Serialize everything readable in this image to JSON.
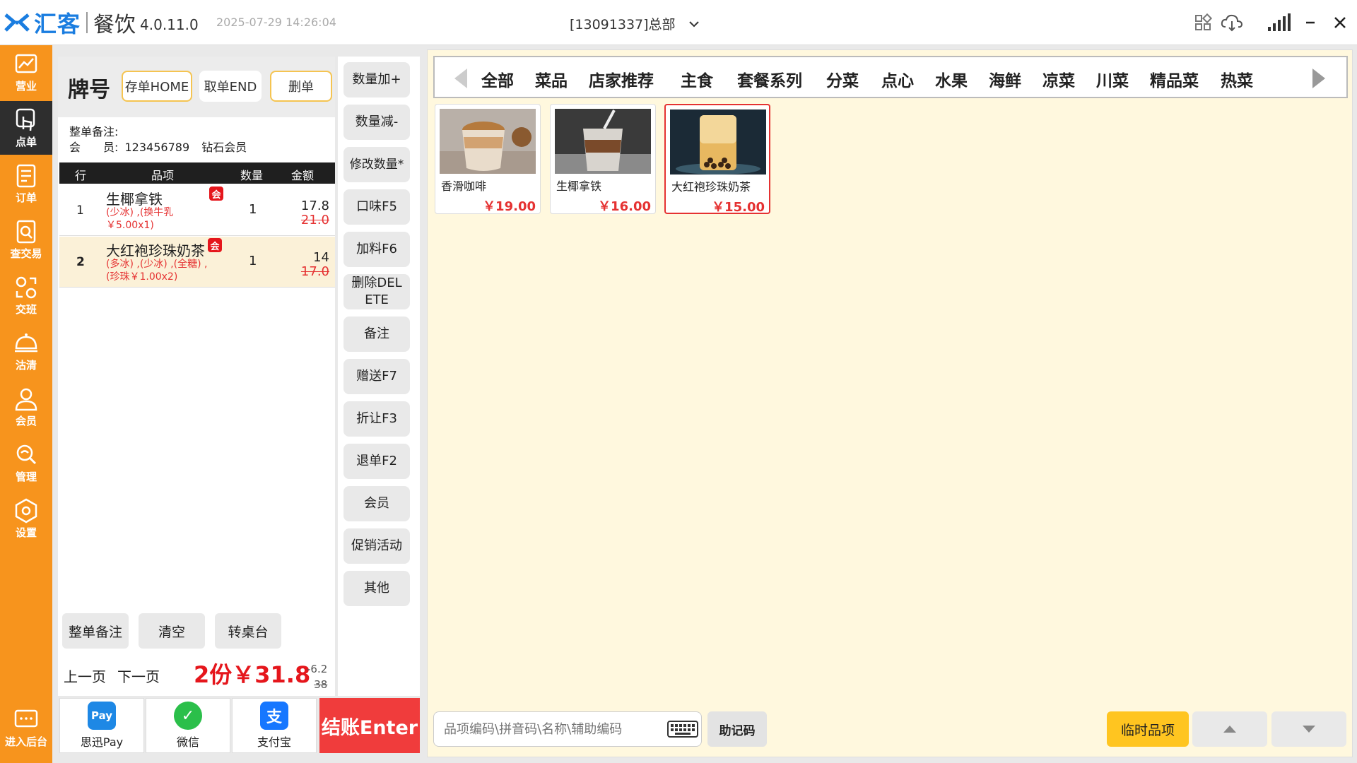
{
  "titlebar": {
    "brand": "汇客",
    "product": "餐饮",
    "version": "4.0.11.0",
    "datetime": "2025-07-29 14:26:04",
    "store": "[13091337]总部"
  },
  "sidebar": {
    "items": [
      {
        "label": "营业",
        "icon": "chart-icon"
      },
      {
        "label": "点单",
        "icon": "touch-icon"
      },
      {
        "label": "订单",
        "icon": "document-icon"
      },
      {
        "label": "查交易",
        "icon": "search-doc-icon"
      },
      {
        "label": "交班",
        "icon": "shift-icon"
      },
      {
        "label": "沽清",
        "icon": "cloche-icon"
      },
      {
        "label": "会员",
        "icon": "user-icon"
      },
      {
        "label": "管理",
        "icon": "wrench-icon"
      },
      {
        "label": "设置",
        "icon": "gear-icon"
      },
      {
        "label": "进入后台",
        "icon": "chat-icon"
      }
    ]
  },
  "order": {
    "header_title": "牌号",
    "btn_save": "存单HOME",
    "btn_take": "取单END",
    "btn_delete": "删单",
    "remark_label": "整单备注:",
    "member_label": "会　　员:",
    "member_id": "123456789",
    "member_level": "钻石会员",
    "columns": [
      "行",
      "品项",
      "数量",
      "金额"
    ],
    "badge": "会",
    "rows": [
      {
        "idx": "1",
        "name": "生椰拿铁",
        "mods1": "(少冰) ,(换牛乳",
        "mods2": "￥5.00x1)",
        "qty": "1",
        "amount": "17.8",
        "original": "21.0"
      },
      {
        "idx": "2",
        "name": "大红袍珍珠奶茶",
        "mods1": "(多冰) ,(少冰) ,(全糖) ,",
        "mods2": "(珍珠￥1.00x2)",
        "qty": "1",
        "amount": "14",
        "original": "17.0"
      }
    ],
    "footer_buttons": [
      "整单备注",
      "清空",
      "转桌台"
    ],
    "prev": "上一页",
    "next": "下一页",
    "total": "2份￥31.8",
    "discount": "-6.2",
    "original_total": "38"
  },
  "payments": [
    {
      "label": "思迅Pay",
      "icon": "pay-icon",
      "color": "#1e88e5",
      "glyph": "Pay"
    },
    {
      "label": "微信",
      "icon": "wechat-icon",
      "color": "#2bbf4a",
      "glyph": "✓"
    },
    {
      "label": "支付宝",
      "icon": "alipay-icon",
      "color": "#1677ff",
      "glyph": "支"
    }
  ],
  "checkout": "结账Enter",
  "actions": [
    "数量加+",
    "数量减-",
    "修改数量*",
    "口味F5",
    "加料F6",
    "删除DELETE",
    "备注",
    "赠送F7",
    "折让F3",
    "退单F2",
    "会员",
    "促销活动",
    "其他"
  ],
  "categories": [
    "全部",
    "菜品",
    "店家推荐",
    "主食",
    "套餐系列",
    "分菜",
    "点心",
    "水果",
    "海鲜",
    "凉菜",
    "川菜",
    "精品菜",
    "热菜"
  ],
  "items": [
    {
      "name": "香滑咖啡",
      "price": "￥19.00"
    },
    {
      "name": "生椰拿铁",
      "price": "￥16.00"
    },
    {
      "name": "大红袍珍珠奶茶",
      "price": "￥15.00"
    }
  ],
  "search": {
    "placeholder": "品项编码\\拼音码\\名称\\辅助编码"
  },
  "mnemonic": "助记码",
  "temp_item": "临时品项",
  "colors": {
    "accent": "#f7941d",
    "danger": "#e53232",
    "menu_bg": "#fff8de",
    "highlight": "#ffc520"
  }
}
